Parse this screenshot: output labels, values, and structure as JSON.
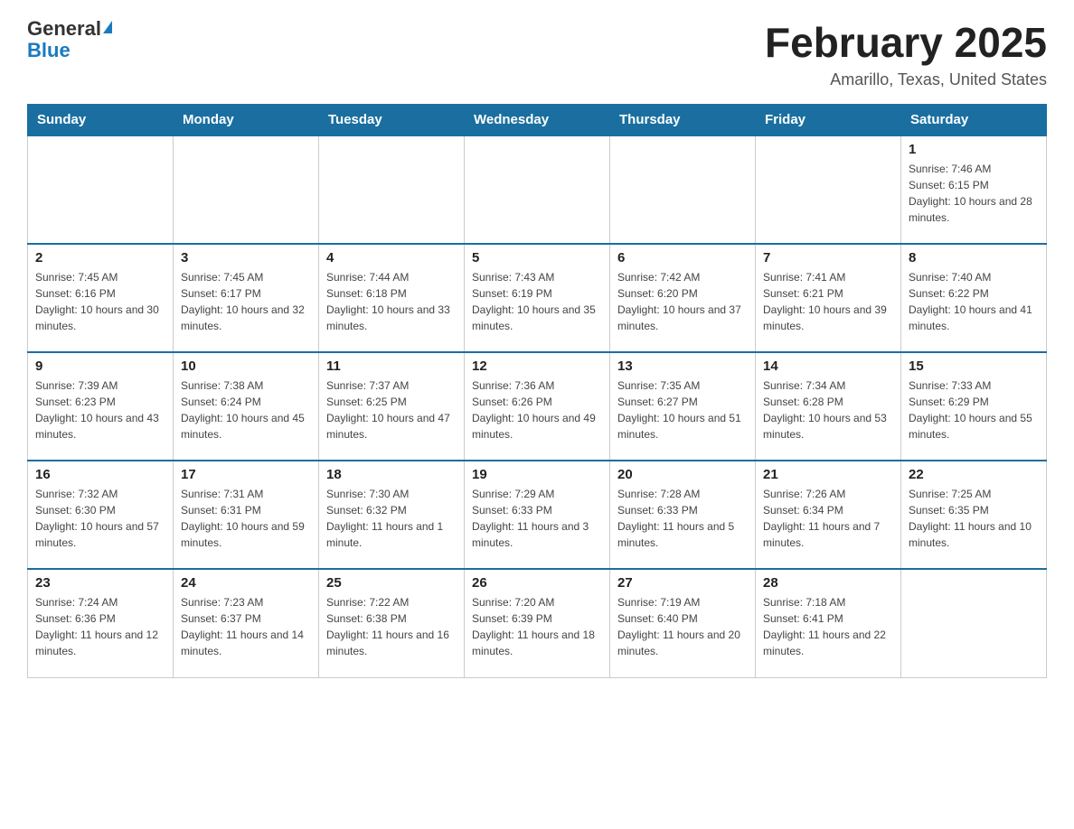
{
  "logo": {
    "general": "General",
    "blue": "Blue"
  },
  "title": "February 2025",
  "subtitle": "Amarillo, Texas, United States",
  "weekdays": [
    "Sunday",
    "Monday",
    "Tuesday",
    "Wednesday",
    "Thursday",
    "Friday",
    "Saturday"
  ],
  "weeks": [
    [
      {
        "day": "",
        "info": ""
      },
      {
        "day": "",
        "info": ""
      },
      {
        "day": "",
        "info": ""
      },
      {
        "day": "",
        "info": ""
      },
      {
        "day": "",
        "info": ""
      },
      {
        "day": "",
        "info": ""
      },
      {
        "day": "1",
        "info": "Sunrise: 7:46 AM\nSunset: 6:15 PM\nDaylight: 10 hours and 28 minutes."
      }
    ],
    [
      {
        "day": "2",
        "info": "Sunrise: 7:45 AM\nSunset: 6:16 PM\nDaylight: 10 hours and 30 minutes."
      },
      {
        "day": "3",
        "info": "Sunrise: 7:45 AM\nSunset: 6:17 PM\nDaylight: 10 hours and 32 minutes."
      },
      {
        "day": "4",
        "info": "Sunrise: 7:44 AM\nSunset: 6:18 PM\nDaylight: 10 hours and 33 minutes."
      },
      {
        "day": "5",
        "info": "Sunrise: 7:43 AM\nSunset: 6:19 PM\nDaylight: 10 hours and 35 minutes."
      },
      {
        "day": "6",
        "info": "Sunrise: 7:42 AM\nSunset: 6:20 PM\nDaylight: 10 hours and 37 minutes."
      },
      {
        "day": "7",
        "info": "Sunrise: 7:41 AM\nSunset: 6:21 PM\nDaylight: 10 hours and 39 minutes."
      },
      {
        "day": "8",
        "info": "Sunrise: 7:40 AM\nSunset: 6:22 PM\nDaylight: 10 hours and 41 minutes."
      }
    ],
    [
      {
        "day": "9",
        "info": "Sunrise: 7:39 AM\nSunset: 6:23 PM\nDaylight: 10 hours and 43 minutes."
      },
      {
        "day": "10",
        "info": "Sunrise: 7:38 AM\nSunset: 6:24 PM\nDaylight: 10 hours and 45 minutes."
      },
      {
        "day": "11",
        "info": "Sunrise: 7:37 AM\nSunset: 6:25 PM\nDaylight: 10 hours and 47 minutes."
      },
      {
        "day": "12",
        "info": "Sunrise: 7:36 AM\nSunset: 6:26 PM\nDaylight: 10 hours and 49 minutes."
      },
      {
        "day": "13",
        "info": "Sunrise: 7:35 AM\nSunset: 6:27 PM\nDaylight: 10 hours and 51 minutes."
      },
      {
        "day": "14",
        "info": "Sunrise: 7:34 AM\nSunset: 6:28 PM\nDaylight: 10 hours and 53 minutes."
      },
      {
        "day": "15",
        "info": "Sunrise: 7:33 AM\nSunset: 6:29 PM\nDaylight: 10 hours and 55 minutes."
      }
    ],
    [
      {
        "day": "16",
        "info": "Sunrise: 7:32 AM\nSunset: 6:30 PM\nDaylight: 10 hours and 57 minutes."
      },
      {
        "day": "17",
        "info": "Sunrise: 7:31 AM\nSunset: 6:31 PM\nDaylight: 10 hours and 59 minutes."
      },
      {
        "day": "18",
        "info": "Sunrise: 7:30 AM\nSunset: 6:32 PM\nDaylight: 11 hours and 1 minute."
      },
      {
        "day": "19",
        "info": "Sunrise: 7:29 AM\nSunset: 6:33 PM\nDaylight: 11 hours and 3 minutes."
      },
      {
        "day": "20",
        "info": "Sunrise: 7:28 AM\nSunset: 6:33 PM\nDaylight: 11 hours and 5 minutes."
      },
      {
        "day": "21",
        "info": "Sunrise: 7:26 AM\nSunset: 6:34 PM\nDaylight: 11 hours and 7 minutes."
      },
      {
        "day": "22",
        "info": "Sunrise: 7:25 AM\nSunset: 6:35 PM\nDaylight: 11 hours and 10 minutes."
      }
    ],
    [
      {
        "day": "23",
        "info": "Sunrise: 7:24 AM\nSunset: 6:36 PM\nDaylight: 11 hours and 12 minutes."
      },
      {
        "day": "24",
        "info": "Sunrise: 7:23 AM\nSunset: 6:37 PM\nDaylight: 11 hours and 14 minutes."
      },
      {
        "day": "25",
        "info": "Sunrise: 7:22 AM\nSunset: 6:38 PM\nDaylight: 11 hours and 16 minutes."
      },
      {
        "day": "26",
        "info": "Sunrise: 7:20 AM\nSunset: 6:39 PM\nDaylight: 11 hours and 18 minutes."
      },
      {
        "day": "27",
        "info": "Sunrise: 7:19 AM\nSunset: 6:40 PM\nDaylight: 11 hours and 20 minutes."
      },
      {
        "day": "28",
        "info": "Sunrise: 7:18 AM\nSunset: 6:41 PM\nDaylight: 11 hours and 22 minutes."
      },
      {
        "day": "",
        "info": ""
      }
    ]
  ]
}
